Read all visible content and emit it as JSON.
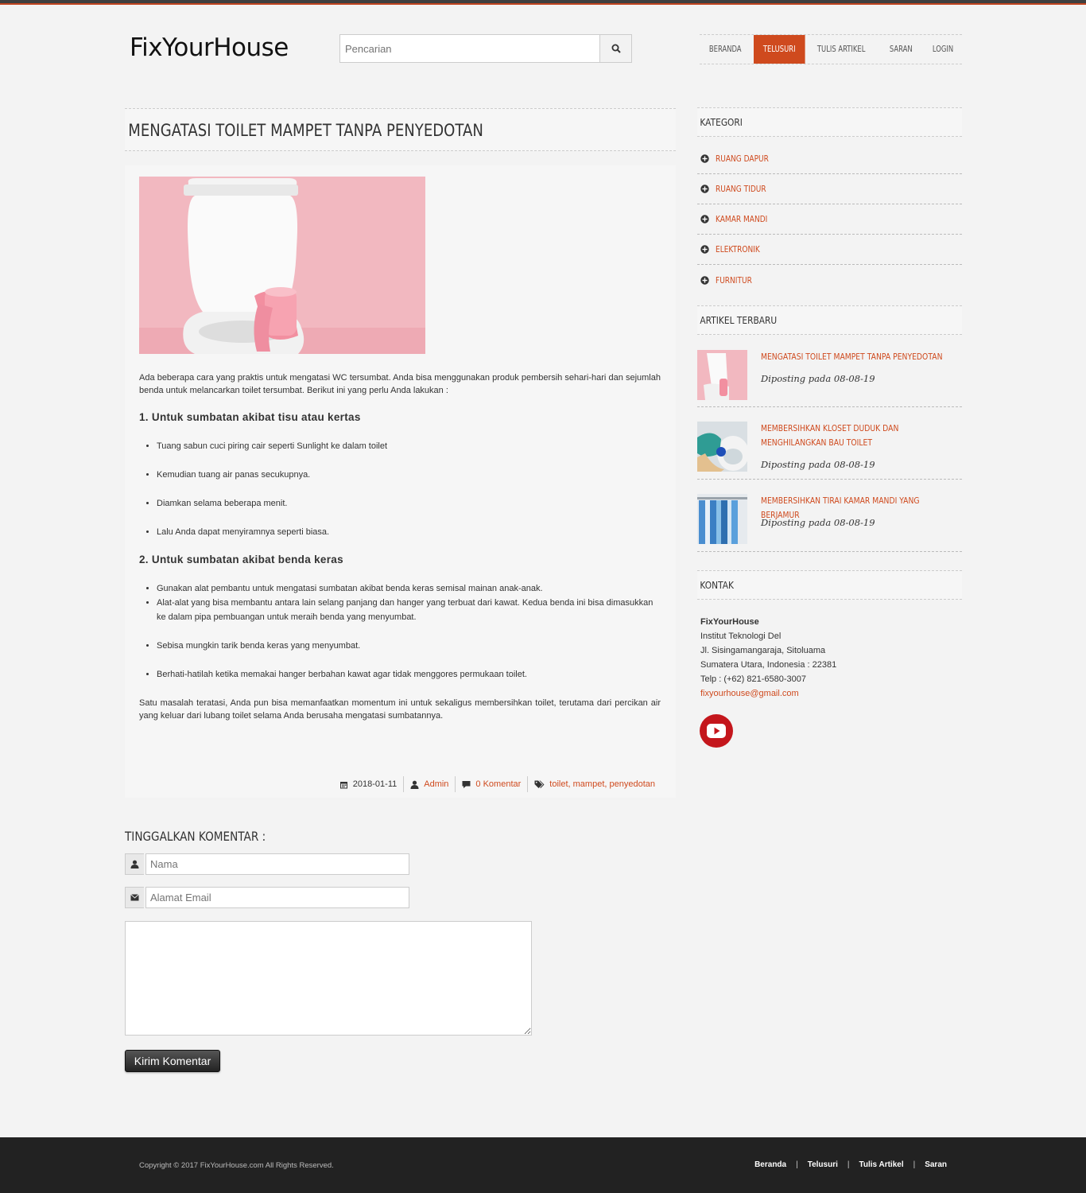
{
  "header": {
    "logo": "FixYourHouse",
    "search_placeholder": "Pencarian",
    "nav": [
      {
        "label": "BERANDA"
      },
      {
        "label": "TELUSURI"
      },
      {
        "label": "TULIS ARTIKEL"
      },
      {
        "label": "SARAN"
      },
      {
        "label": "LOGIN"
      }
    ],
    "active_nav": "TELUSURI"
  },
  "article": {
    "title": "MENGATASI TOILET MAMPET TANPA PENYEDOTAN",
    "intro": "Ada beberapa cara yang praktis untuk mengatasi WC tersumbat. Anda bisa menggunakan produk pembersih sehari-hari dan sejumlah benda untuk melancarkan toilet tersumbat. Berikut ini yang perlu Anda lakukan :",
    "section1_title": "1. Untuk sumbatan akibat tisu atau kertas",
    "section1_items": [
      "Tuang sabun cuci piring cair seperti Sunlight ke dalam toilet",
      "Kemudian tuang air panas secukupnya.",
      "Diamkan selama beberapa menit.",
      "Lalu Anda dapat menyiramnya seperti biasa."
    ],
    "section2_title": "2. Untuk sumbatan akibat benda keras",
    "section2_items": [
      "Gunakan alat pembantu untuk mengatasi sumbatan akibat benda keras semisal mainan anak-anak.",
      "Alat-alat yang bisa membantu antara lain selang panjang dan hanger yang terbuat dari kawat. Kedua benda ini bisa dimasukkan ke dalam pipa pembuangan untuk meraih benda yang menyumbat.",
      "Sebisa mungkin tarik benda keras yang menyumbat.",
      "Berhati-hatilah ketika memakai hanger berbahan kawat agar tidak menggores permukaan toilet."
    ],
    "outro": "Satu masalah teratasi, Anda pun bisa memanfaatkan momentum ini untuk sekaligus membersihkan toilet, terutama dari percikan air yang keluar dari lubang toilet selama Anda berusaha mengatasi sumbatannya.",
    "meta": {
      "date": "2018-01-11",
      "author": "Admin",
      "comments": "0 Komentar",
      "tags": "toilet, mampet, penyedotan"
    }
  },
  "comment_form": {
    "title": "TINGGALKAN KOMENTAR :",
    "name_placeholder": "Nama",
    "email_placeholder": "Alamat Email",
    "submit_label": "Kirim Komentar"
  },
  "sidebar": {
    "category_title": "KATEGORI",
    "categories": [
      "RUANG DAPUR",
      "RUANG TIDUR",
      "KAMAR MANDI",
      "ELEKTRONIK",
      "FURNITUR"
    ],
    "recent_title": "ARTIKEL TERBARU",
    "recent": [
      {
        "title": "MENGATASI TOILET MAMPET TANPA PENYEDOTAN",
        "date": "Diposting pada 08-08-19"
      },
      {
        "title": "MEMBERSIHKAN KLOSET DUDUK DAN MENGHILANGKAN BAU TOILET",
        "date": "Diposting pada 08-08-19"
      },
      {
        "title": "MEMBERSIHKAN TIRAI KAMAR MANDI YANG BERJAMUR",
        "date": "Diposting pada 08-08-19"
      }
    ],
    "contact_title": "KONTAK",
    "contact": {
      "name": "FixYourHouse",
      "line1": "Institut Teknologi Del",
      "line2": "Jl. Sisingamangaraja, Sitoluama",
      "line3": "Sumatera Utara, Indonesia : 22381",
      "phone": "Telp : (+62) 821-6580-3007",
      "email": "fixyourhouse@gmail.com"
    }
  },
  "footer": {
    "copyright": "Copyright © 2017 FixYourHouse.com All Rights Reserved.",
    "links": [
      "Beranda",
      "Telusuri",
      "Tulis Artikel",
      "Saran"
    ]
  },
  "colors": {
    "accent": "#cf4a1e",
    "footer": "#222222",
    "youtube": "#c4161c"
  }
}
